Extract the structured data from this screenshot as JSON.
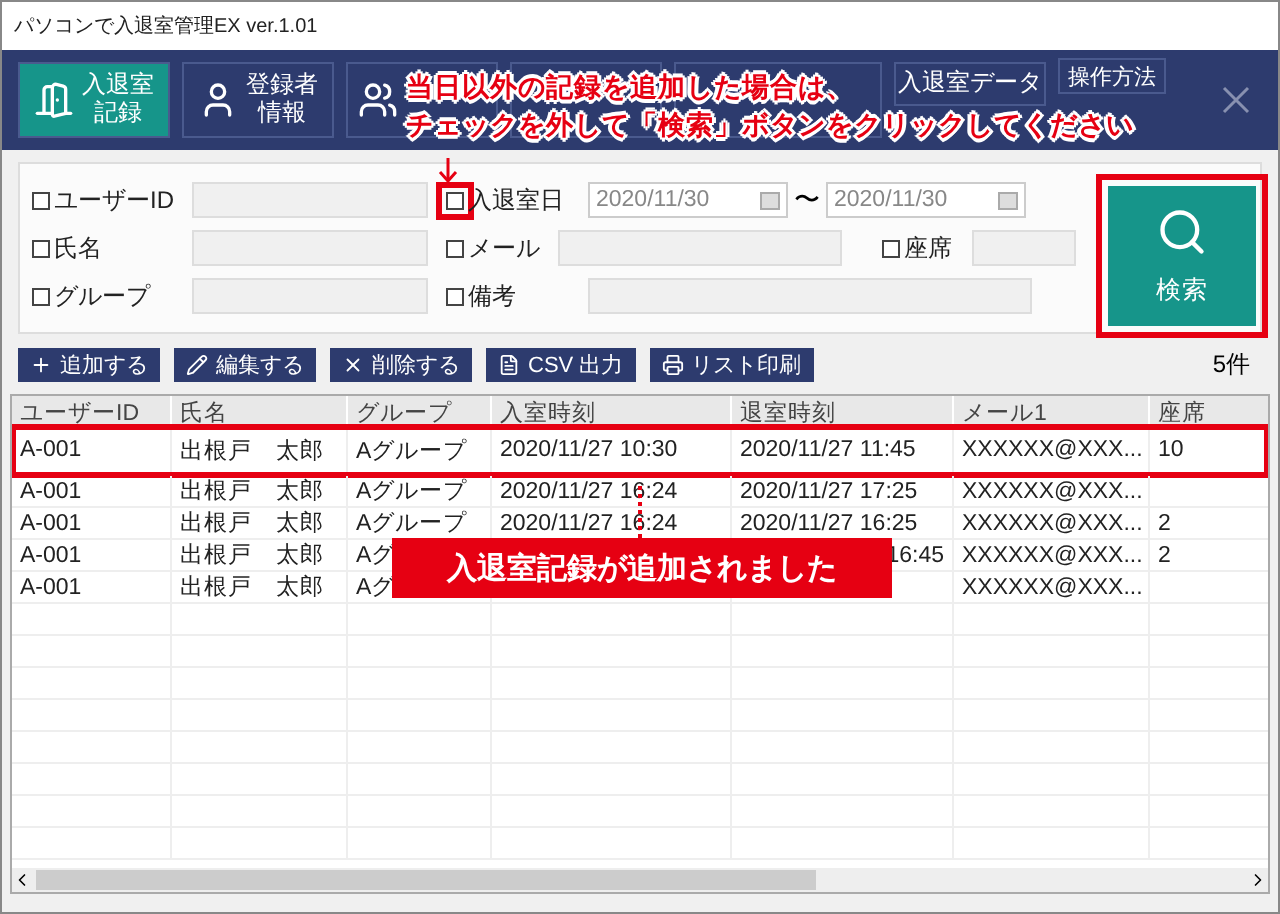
{
  "window": {
    "title": "パソコンで入退室管理EX ver.1.01"
  },
  "nav": [
    {
      "kind": "tab",
      "label": "入退室記録",
      "selected": true
    },
    {
      "kind": "tab",
      "label": "登録者情報",
      "selected": false
    },
    {
      "kind": "tab",
      "selected": false
    },
    {
      "kind": "tab",
      "selected": false
    },
    {
      "kind": "tab",
      "selected": false
    },
    {
      "kind": "tab",
      "label": "入退室データ",
      "selected": false
    },
    {
      "kind": "small",
      "label": "操作方法",
      "selected": false
    }
  ],
  "callout": {
    "lines": [
      "当日以外の記録を追加した場合は、",
      "チェックを外して「検索」ボタンをクリックしてください"
    ]
  },
  "search": {
    "rows": [
      [
        {
          "label": "ユーザーID",
          "checked": false
        },
        {
          "label": "入退室日",
          "checked": false,
          "highlighted": true,
          "date_from": "2020/11/30",
          "date_to": "2020/11/30",
          "separator": "〜"
        }
      ],
      [
        {
          "label": "氏名",
          "checked": false
        },
        {
          "label": "メール",
          "checked": false
        },
        {
          "label": "座席",
          "checked": false
        }
      ],
      [
        {
          "label": "グループ",
          "checked": false
        },
        {
          "label": "備考",
          "checked": false
        }
      ]
    ],
    "button": "検索"
  },
  "toolbar": [
    "追加する",
    "編集する",
    "削除する",
    "CSV 出力",
    "リスト印刷"
  ],
  "count": "5件",
  "table": {
    "columns": [
      "ユーザーID",
      "氏名",
      "グループ",
      "入室時刻",
      "退室時刻",
      "メール1",
      "座席"
    ],
    "rows": [
      {
        "highlighted": true,
        "cells": [
          "A-001",
          "出根戸　太郎",
          "Aグループ",
          "2020/11/27 10:30",
          "2020/11/27 11:45",
          "XXXXXX@XXX...",
          "10"
        ]
      },
      {
        "highlighted": false,
        "cells": [
          "A-001",
          "出根戸　太郎",
          "Aグループ",
          "2020/11/27 16:24",
          "2020/11/27 17:25",
          "XXXXXX@XXX...",
          null
        ]
      },
      {
        "highlighted": false,
        "cells": [
          "A-001",
          "出根戸　太郎",
          "Aグループ",
          "2020/11/27 16:24",
          "2020/11/27 16:25",
          "XXXXXX@XXX...",
          "2"
        ]
      },
      {
        "highlighted": false,
        "cells": [
          "A-001",
          "出根戸　太郎",
          "Aグ",
          null,
          "16:45",
          "XXXXXX@XXX...",
          "2"
        ]
      },
      {
        "highlighted": false,
        "cells": [
          "A-001",
          "出根戸　太郎",
          "Aグ",
          null,
          null,
          "XXXXXX@XXX...",
          null
        ]
      }
    ]
  },
  "banner": "入退室記録が追加されました"
}
